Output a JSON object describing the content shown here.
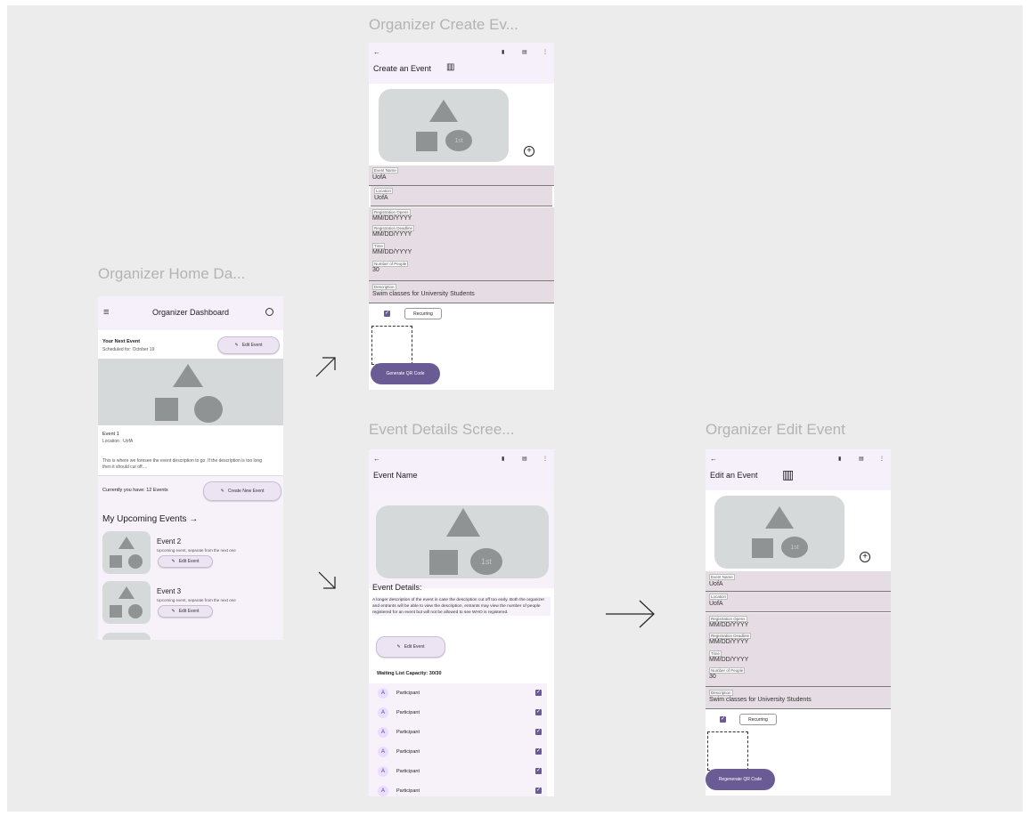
{
  "frames": {
    "home_title": "Organizer Home Da...",
    "create_title": "Organizer Create Ev...",
    "details_title": "Event Details Scree...",
    "edit_title": "Organizer Edit Event"
  },
  "home": {
    "app_title": "Organizer Dashboard",
    "next_event_label": "Your Next Event",
    "scheduled": "Scheduled for: October 19",
    "edit_event": "Edit Event",
    "event_name": "Event 1",
    "location": "Location : UofA",
    "description": "This is where we foresee the event description to go. If the description is too long then it should cut off....",
    "currently": "Currently you have: 12 Events",
    "create_new": "Create New Event",
    "upcoming_title": "My Upcoming Events",
    "upcoming": [
      {
        "name": "Event 2",
        "desc": "Upcoming event, separate from the next one",
        "btn": "Edit Event"
      },
      {
        "name": "Event 3",
        "desc": "Upcoming event, separate from the next one",
        "btn": "Edit Event"
      }
    ]
  },
  "create": {
    "title": "Create an Event",
    "badge": "1st",
    "fields": {
      "event_name_label": "Event Name",
      "event_name": "UofA",
      "location_label": "Location",
      "location": "UofA",
      "reg_open_label": "Registration Opens",
      "reg_open": "MM/DD/YYYY",
      "reg_deadline_label": "Registration Deadline",
      "reg_deadline": "MM/DD/YYYY",
      "time_label": "Time",
      "time": "MM/DD/YYYY",
      "people_label": "Number of People",
      "people": "30",
      "desc_label": "Description",
      "desc": "Swim classes for University Students"
    },
    "recurring": "Recurring",
    "generate": "Generate QR Code"
  },
  "details": {
    "title": "Event Name",
    "badge": "1st",
    "heading": "Event Details:",
    "description": "A longer description of the event in case the description cut off too early. Both the organizer and entrants will be able to view the description, entrants may view the number of people registered for an event but will not be allowed to see WHO is registered.",
    "edit_event": "Edit Event",
    "waiting": "Waiting List Capacity: 30/30",
    "participants": [
      {
        "avatar": "A",
        "name": "Participant"
      },
      {
        "avatar": "A",
        "name": "Participant"
      },
      {
        "avatar": "A",
        "name": "Participant"
      },
      {
        "avatar": "A",
        "name": "Participant"
      },
      {
        "avatar": "A",
        "name": "Participant"
      },
      {
        "avatar": "A",
        "name": "Participant"
      }
    ]
  },
  "edit": {
    "title": "Edit an Event",
    "badge": "1st",
    "fields": {
      "event_name_label": "Event Name",
      "event_name": "UofA",
      "location_label": "Location",
      "location": "UofA",
      "reg_open_label": "Registration Opens",
      "reg_open": "MM/DD/YYYY",
      "reg_deadline_label": "Registration Deadline",
      "reg_deadline": "MM/DD/YYYY",
      "time_label": "Time",
      "time": "MM/DD/YYYY",
      "people_label": "Number of People",
      "people": "30",
      "desc_label": "Description",
      "desc": "Swim classes for University Students"
    },
    "recurring": "Recurring",
    "regenerate": "Regenerate QR Code"
  },
  "icons": {
    "menu": "menu-icon",
    "account": "account-circle-icon",
    "back": "back-arrow-icon",
    "attach": "attach-icon",
    "calendar": "calendar-icon",
    "more": "more-vert-icon",
    "book": "book-icon",
    "add": "add-circle-icon",
    "pencil": "pencil-icon"
  },
  "colors": {
    "primary": "#6b5b95",
    "surface_tint": "#f6f0fa",
    "field_bg": "#e6dce4",
    "placeholder": "#d5d9d9"
  }
}
